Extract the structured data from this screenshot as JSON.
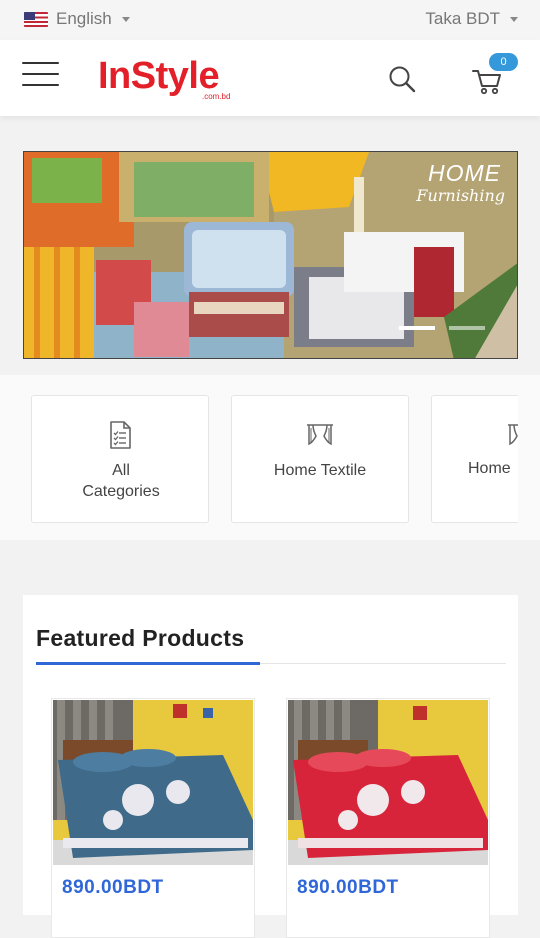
{
  "topbar": {
    "language": "English",
    "currency": "Taka BDT"
  },
  "header": {
    "logo_text": "InStyle",
    "logo_sub": ".com.bd",
    "cart_count": "0"
  },
  "banner": {
    "title": "HOME",
    "subtitle": "Furnishing",
    "slide_count": 2,
    "active_slide": 0
  },
  "categories": [
    {
      "label": "All Categories",
      "icon": "list-document-icon"
    },
    {
      "label": "Home Textile",
      "icon": "curtain-icon"
    },
    {
      "label": "Home",
      "icon": "curtain-icon"
    }
  ],
  "featured": {
    "title": "Featured Products",
    "products": [
      {
        "price": "890.00BDT",
        "color": "#3f6a8a"
      },
      {
        "price": "890.00BDT",
        "color": "#d8243a"
      }
    ]
  }
}
